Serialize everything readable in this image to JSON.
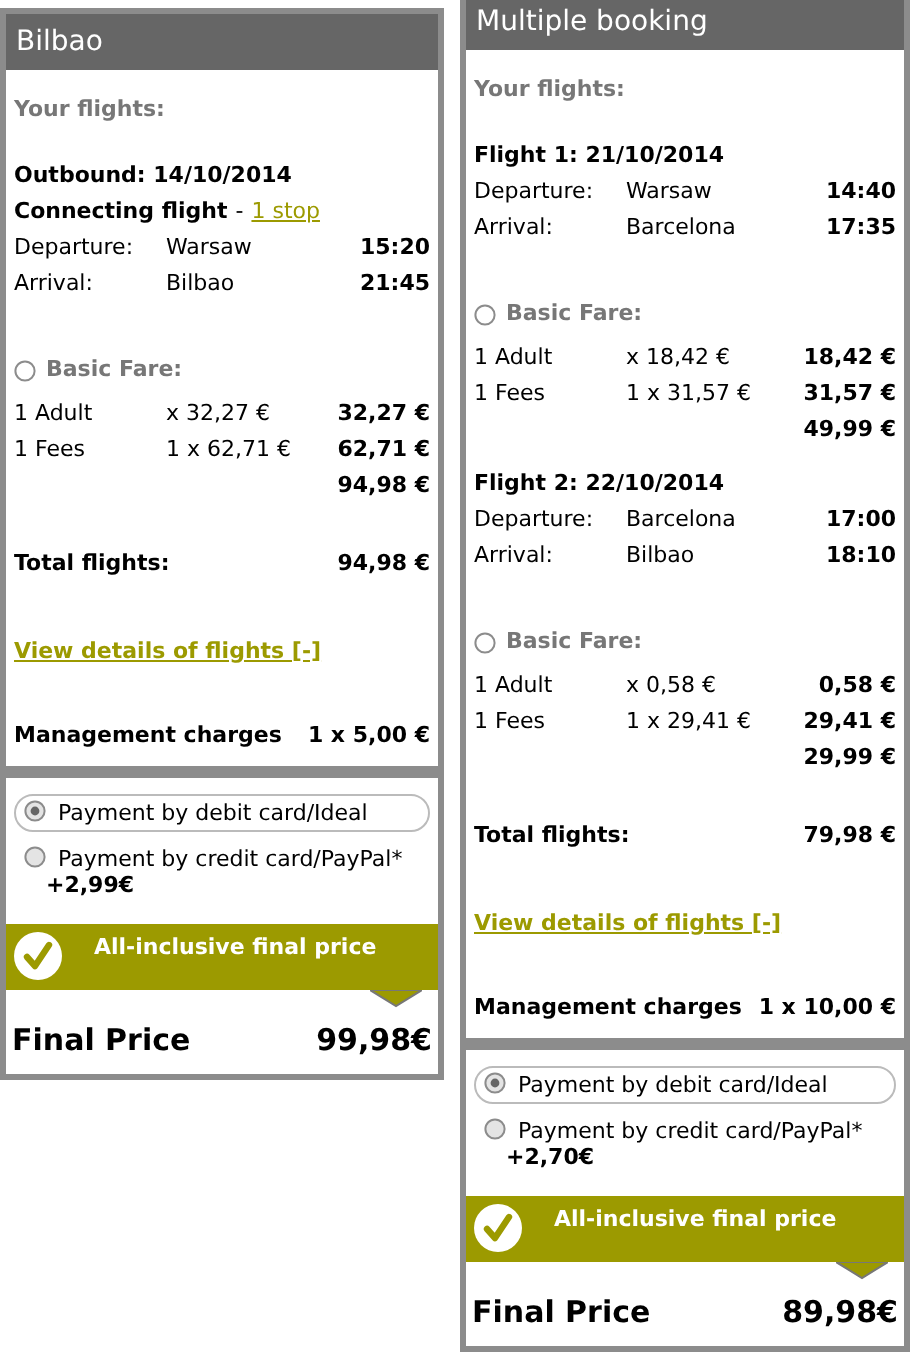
{
  "panels": [
    {
      "title": "Bilbao",
      "your_flights": "Your flights:",
      "flights": [
        {
          "heading": "Outbound: 14/10/2014",
          "connection": {
            "label": "Connecting flight",
            "separator": "-",
            "link": "1 stop"
          },
          "legs": [
            {
              "label": "Departure:",
              "place": "Warsaw",
              "time": "15:20"
            },
            {
              "label": "Arrival:",
              "place": "Bilbao",
              "time": "21:45"
            }
          ],
          "fare": {
            "label": "Basic Fare:",
            "selected": false,
            "lines": [
              {
                "label": "1 Adult",
                "unit": "x 32,27 €",
                "amount": "32,27 €"
              },
              {
                "label": "1 Fees",
                "unit": "1 x 62,71 €",
                "amount": "62,71 €"
              }
            ],
            "total": "94,98 €"
          }
        }
      ],
      "total_flights": {
        "label": "Total flights:",
        "value": "94,98 €"
      },
      "details_link": "View details of flights [-]",
      "management": {
        "label": "Management charges",
        "value": "1 x 5,00 €"
      },
      "payments": [
        {
          "label": "Payment by debit card/Ideal",
          "selected": true
        },
        {
          "label": "Payment by credit card/PayPal*",
          "surcharge": "+2,99€",
          "selected": false
        }
      ],
      "banner": "All-inclusive final price",
      "final": {
        "label": "Final Price",
        "value": "99,98€"
      }
    },
    {
      "title": "Multiple booking",
      "your_flights": "Your flights:",
      "flights": [
        {
          "heading": "Flight 1: 21/10/2014",
          "legs": [
            {
              "label": "Departure:",
              "place": "Warsaw",
              "time": "14:40"
            },
            {
              "label": "Arrival:",
              "place": "Barcelona",
              "time": "17:35"
            }
          ],
          "fare": {
            "label": "Basic Fare:",
            "selected": false,
            "lines": [
              {
                "label": "1 Adult",
                "unit": "x 18,42 €",
                "amount": "18,42 €"
              },
              {
                "label": "1 Fees",
                "unit": "1 x 31,57 €",
                "amount": "31,57 €"
              }
            ],
            "total": "49,99 €"
          }
        },
        {
          "heading": "Flight 2: 22/10/2014",
          "legs": [
            {
              "label": "Departure:",
              "place": "Barcelona",
              "time": "17:00"
            },
            {
              "label": "Arrival:",
              "place": "Bilbao",
              "time": "18:10"
            }
          ],
          "fare": {
            "label": "Basic Fare:",
            "selected": false,
            "lines": [
              {
                "label": "1 Adult",
                "unit": "x 0,58 €",
                "amount": "0,58 €"
              },
              {
                "label": "1 Fees",
                "unit": "1 x 29,41 €",
                "amount": "29,41 €"
              }
            ],
            "total": "29,99 €"
          }
        }
      ],
      "total_flights": {
        "label": "Total flights:",
        "value": "79,98 €"
      },
      "details_link": "View details of flights [-]",
      "management": {
        "label": "Management charges",
        "value": "1 x 10,00 €"
      },
      "payments": [
        {
          "label": "Payment by debit card/Ideal",
          "selected": true
        },
        {
          "label": "Payment by credit card/PayPal*",
          "surcharge": "+2,70€",
          "selected": false
        }
      ],
      "banner": "All-inclusive final price",
      "final": {
        "label": "Final Price",
        "value": "89,98€"
      }
    }
  ]
}
